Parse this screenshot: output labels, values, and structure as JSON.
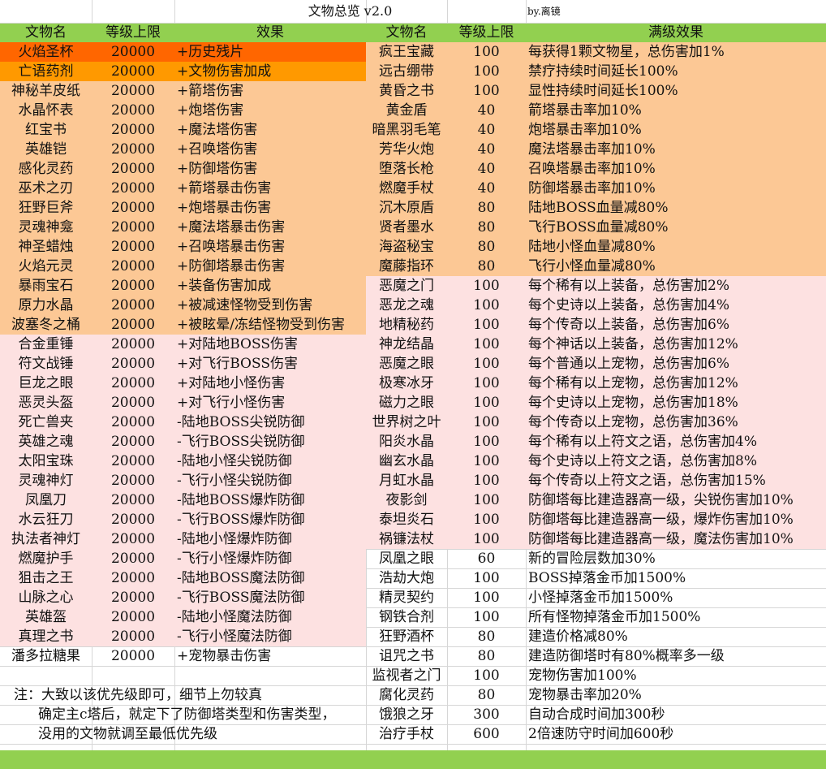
{
  "title": "文物总览  v2.0",
  "author": "by.离镜",
  "colors": {
    "header": "#92d050",
    "orange": "#ff6600",
    "amber": "#ff9900",
    "peach": "#fcc895",
    "pink": "#fde1e1",
    "green_bar": "#92d050"
  },
  "headers": {
    "name": "文物名",
    "level": "等级上限",
    "effect": "效果",
    "name2": "文物名",
    "level2": "等级上限",
    "max_effect": "满级效果"
  },
  "left_rows": [
    {
      "name": "火焰圣杯",
      "level": "20000",
      "effect": "+历史残片",
      "bg": "orange"
    },
    {
      "name": "亡语药剂",
      "level": "20000",
      "effect": "+文物伤害加成",
      "bg": "amber"
    },
    {
      "name": "神秘羊皮纸",
      "level": "20000",
      "effect": "+箭塔伤害",
      "bg": "peach"
    },
    {
      "name": "水晶怀表",
      "level": "20000",
      "effect": "+炮塔伤害",
      "bg": "peach"
    },
    {
      "name": "红宝书",
      "level": "20000",
      "effect": "+魔法塔伤害",
      "bg": "peach"
    },
    {
      "name": "英雄铠",
      "level": "20000",
      "effect": "+召唤塔伤害",
      "bg": "peach"
    },
    {
      "name": "感化灵药",
      "level": "20000",
      "effect": "+防御塔伤害",
      "bg": "peach"
    },
    {
      "name": "巫术之刃",
      "level": "20000",
      "effect": "+箭塔暴击伤害",
      "bg": "peach"
    },
    {
      "name": "狂野巨斧",
      "level": "20000",
      "effect": "+炮塔暴击伤害",
      "bg": "peach"
    },
    {
      "name": "灵魂神龛",
      "level": "20000",
      "effect": "+魔法塔暴击伤害",
      "bg": "peach"
    },
    {
      "name": "神圣蜡烛",
      "level": "20000",
      "effect": "+召唤塔暴击伤害",
      "bg": "peach"
    },
    {
      "name": "火焰元灵",
      "level": "20000",
      "effect": "+防御塔暴击伤害",
      "bg": "peach"
    },
    {
      "name": "暴雨宝石",
      "level": "20000",
      "effect": "+装备伤害加成",
      "bg": "peach"
    },
    {
      "name": "原力水晶",
      "level": "20000",
      "effect": "+被减速怪物受到伤害",
      "bg": "peach"
    },
    {
      "name": "波塞冬之桶",
      "level": "20000",
      "effect": "+被眩晕/冻结怪物受到伤害",
      "bg": "peach"
    },
    {
      "name": "合金重锤",
      "level": "20000",
      "effect": "+对陆地BOSS伤害",
      "bg": "pink"
    },
    {
      "name": "符文战锤",
      "level": "20000",
      "effect": "+对飞行BOSS伤害",
      "bg": "pink"
    },
    {
      "name": "巨龙之眼",
      "level": "20000",
      "effect": "+对陆地小怪伤害",
      "bg": "pink"
    },
    {
      "name": "恶灵头盔",
      "level": "20000",
      "effect": "+对飞行小怪伤害",
      "bg": "pink"
    },
    {
      "name": "死亡兽夹",
      "level": "20000",
      "effect": "-陆地BOSS尖锐防御",
      "bg": "pink"
    },
    {
      "name": "英雄之魂",
      "level": "20000",
      "effect": "-飞行BOSS尖锐防御",
      "bg": "pink"
    },
    {
      "name": "太阳宝珠",
      "level": "20000",
      "effect": "-陆地小怪尖锐防御",
      "bg": "pink"
    },
    {
      "name": "灵魂神灯",
      "level": "20000",
      "effect": "-飞行小怪尖锐防御",
      "bg": "pink"
    },
    {
      "name": "凤凰刀",
      "level": "20000",
      "effect": "-陆地BOSS爆炸防御",
      "bg": "pink"
    },
    {
      "name": "水云狂刀",
      "level": "20000",
      "effect": "-飞行BOSS爆炸防御",
      "bg": "pink"
    },
    {
      "name": "执法者神灯",
      "level": "20000",
      "effect": "-陆地小怪爆炸防御",
      "bg": "pink"
    },
    {
      "name": "燃魔护手",
      "level": "20000",
      "effect": "-飞行小怪爆炸防御",
      "bg": "pink"
    },
    {
      "name": "狙击之王",
      "level": "20000",
      "effect": "-陆地BOSS魔法防御",
      "bg": "pink"
    },
    {
      "name": "山脉之心",
      "level": "20000",
      "effect": "-飞行BOSS魔法防御",
      "bg": "pink"
    },
    {
      "name": "英雄盔",
      "level": "20000",
      "effect": "-陆地小怪魔法防御",
      "bg": "pink"
    },
    {
      "name": "真理之书",
      "level": "20000",
      "effect": "-飞行小怪魔法防御",
      "bg": "pink"
    },
    {
      "name": "潘多拉糖果",
      "level": "20000",
      "effect": "+宠物暴击伤害",
      "bg": "white"
    }
  ],
  "right_rows": [
    {
      "name": "疯王宝藏",
      "level": "100",
      "effect": "每获得1颗文物星，总伤害加1%",
      "bg": "peach"
    },
    {
      "name": "远古绷带",
      "level": "100",
      "effect": "禁疗持续时间延长100%",
      "bg": "peach"
    },
    {
      "name": "黄昏之书",
      "level": "100",
      "effect": "显性持续时间延长100%",
      "bg": "peach"
    },
    {
      "name": "黄金盾",
      "level": "40",
      "effect": "箭塔暴击率加10%",
      "bg": "peach"
    },
    {
      "name": "暗黑羽毛笔",
      "level": "40",
      "effect": "炮塔暴击率加10%",
      "bg": "peach"
    },
    {
      "name": "芳华火炮",
      "level": "40",
      "effect": "魔法塔暴击率加10%",
      "bg": "peach"
    },
    {
      "name": "堕落长枪",
      "level": "40",
      "effect": "召唤塔暴击率加10%",
      "bg": "peach"
    },
    {
      "name": "燃魔手杖",
      "level": "40",
      "effect": "防御塔暴击率加10%",
      "bg": "peach"
    },
    {
      "name": "沉木原盾",
      "level": "80",
      "effect": "陆地BOSS血量减80%",
      "bg": "peach"
    },
    {
      "name": "贤者墨水",
      "level": "80",
      "effect": "飞行BOSS血量减80%",
      "bg": "peach"
    },
    {
      "name": "海盗秘宝",
      "level": "80",
      "effect": "陆地小怪血量减80%",
      "bg": "peach"
    },
    {
      "name": "魔藤指环",
      "level": "80",
      "effect": "飞行小怪血量减80%",
      "bg": "peach"
    },
    {
      "name": "恶魔之门",
      "level": "100",
      "effect": "每个稀有以上装备，总伤害加2%",
      "bg": "pink"
    },
    {
      "name": "恶龙之魂",
      "level": "100",
      "effect": "每个史诗以上装备，总伤害加4%",
      "bg": "pink"
    },
    {
      "name": "地精秘药",
      "level": "100",
      "effect": "每个传奇以上装备，总伤害加6%",
      "bg": "pink"
    },
    {
      "name": "神龙结晶",
      "level": "100",
      "effect": "每个神话以上装备，总伤害加12%",
      "bg": "pink"
    },
    {
      "name": "恶魔之眼",
      "level": "100",
      "effect": "每个普通以上宠物，总伤害加6%",
      "bg": "pink"
    },
    {
      "name": "极寒冰牙",
      "level": "100",
      "effect": "每个稀有以上宠物，总伤害加12%",
      "bg": "pink"
    },
    {
      "name": "磁力之眼",
      "level": "100",
      "effect": "每个史诗以上宠物，总伤害加18%",
      "bg": "pink"
    },
    {
      "name": "世界树之叶",
      "level": "100",
      "effect": "每个传奇以上宠物，总伤害加36%",
      "bg": "pink"
    },
    {
      "name": "阳炎水晶",
      "level": "100",
      "effect": "每个稀有以上符文之语，总伤害加4%",
      "bg": "pink"
    },
    {
      "name": "幽玄水晶",
      "level": "100",
      "effect": "每个史诗以上符文之语，总伤害加8%",
      "bg": "pink"
    },
    {
      "name": "月虹水晶",
      "level": "100",
      "effect": "每个传奇以上符文之语，总伤害加15%",
      "bg": "pink"
    },
    {
      "name": "夜影剑",
      "level": "100",
      "effect": "防御塔每比建造器高一级，尖锐伤害加10%",
      "bg": "pink"
    },
    {
      "name": "泰坦炎石",
      "level": "100",
      "effect": "防御塔每比建造器高一级，爆炸伤害加10%",
      "bg": "pink"
    },
    {
      "name": "祸镰法杖",
      "level": "100",
      "effect": "防御塔每比建造器高一级，魔法伤害加10%",
      "bg": "pink"
    },
    {
      "name": "凤凰之眼",
      "level": "60",
      "effect": "新的冒险层数加30%",
      "bg": "white"
    },
    {
      "name": "浩劫大炮",
      "level": "100",
      "effect": "BOSS掉落金币加1500%",
      "bg": "white"
    },
    {
      "name": "精灵契约",
      "level": "100",
      "effect": "小怪掉落金币加1500%",
      "bg": "white"
    },
    {
      "name": "钢铁合剂",
      "level": "100",
      "effect": "所有怪物掉落金币加1500%",
      "bg": "white"
    },
    {
      "name": "狂野酒杯",
      "level": "80",
      "effect": "建造价格减80%",
      "bg": "white"
    },
    {
      "name": "诅咒之书",
      "level": "80",
      "effect": "建造防御塔时有80%概率多一级",
      "bg": "white"
    },
    {
      "name": "监视者之门",
      "level": "100",
      "effect": "宠物伤害加100%",
      "bg": "white"
    },
    {
      "name": "腐化灵药",
      "level": "80",
      "effect": "宠物暴击率加20%",
      "bg": "white"
    },
    {
      "name": "饿狼之牙",
      "level": "300",
      "effect": "自动合成时间加300秒",
      "bg": "white"
    },
    {
      "name": "治疗手杖",
      "level": "600",
      "effect": "2倍速防守时间加600秒",
      "bg": "white"
    }
  ],
  "notes": [
    "注：大致以该优先级即可，细节上勿较真",
    "确定主c塔后，就定下了防御塔类型和伤害类型，",
    "没用的文物就调至最低优先级"
  ]
}
